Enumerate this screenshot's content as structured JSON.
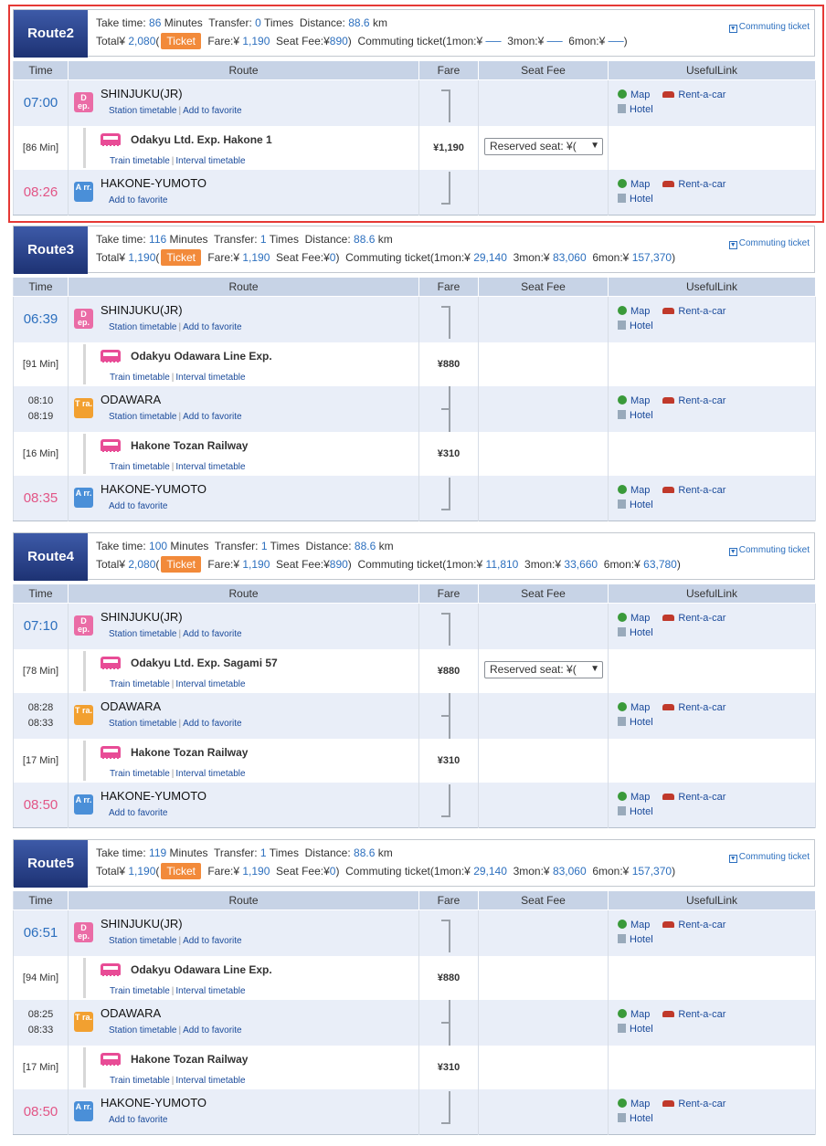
{
  "labels": {
    "time": "Time",
    "route": "Route",
    "fare": "Fare",
    "seat_fee": "Seat Fee",
    "useful_link": "UsefulLink",
    "take_time": "Take time:",
    "minutes": "Minutes",
    "transfer": "Transfer:",
    "times": "Times",
    "distance": "Distance:",
    "km": "km",
    "total": "Total¥",
    "ticket": "Ticket",
    "fare_label": "Fare:¥",
    "seat_fee_label": "Seat Fee:¥",
    "commuting_open": "Commuting ticket(1mon:¥",
    "m3": "3mon:¥",
    "m6": "6mon:¥",
    "close_paren": ")",
    "commuting_link": "Commuting ticket",
    "station_timetable": "Station timetable",
    "add_favorite": "Add to favorite",
    "train_timetable": "Train timetable",
    "interval_timetable": "Interval timetable",
    "map": "Map",
    "rent_a_car": "Rent-a-car",
    "hotel": "Hotel",
    "separator": "|",
    "dep_badge": "D ep.",
    "arr_badge": "A rr.",
    "tra_badge": "T ra."
  },
  "routes": [
    {
      "name": "Route2",
      "take_time": "86",
      "transfer": "0",
      "distance": "88.6",
      "total": "2,080",
      "fare": "1,190",
      "seat_fee": "890",
      "c1": "──",
      "c3": "──",
      "c6": "──",
      "dep_time": "07:00",
      "dep_station": "SHINJUKU(JR)",
      "leg1_duration": "[86 Min]",
      "leg1_train": "Odakyu Ltd. Exp. Hakone 1",
      "leg1_fare": "¥1,190",
      "leg1_seat": "Reserved seat: ¥(",
      "arr_time": "08:26",
      "arr_station": "HAKONE-YUMOTO"
    },
    {
      "name": "Route3",
      "take_time": "116",
      "transfer": "1",
      "distance": "88.6",
      "total": "1,190",
      "fare": "1,190",
      "seat_fee": "0",
      "c1": "29,140",
      "c3": "83,060",
      "c6": "157,370",
      "dep_time": "06:39",
      "dep_station": "SHINJUKU(JR)",
      "leg1_duration": "[91 Min]",
      "leg1_train": "Odakyu Odawara Line Exp.",
      "leg1_fare": "¥880",
      "tr_arr": "08:10",
      "tr_dep": "08:19",
      "tr_station": "ODAWARA",
      "leg2_duration": "[16 Min]",
      "leg2_train": "Hakone Tozan Railway",
      "leg2_fare": "¥310",
      "arr_time": "08:35",
      "arr_station": "HAKONE-YUMOTO"
    },
    {
      "name": "Route4",
      "take_time": "100",
      "transfer": "1",
      "distance": "88.6",
      "total": "2,080",
      "fare": "1,190",
      "seat_fee": "890",
      "c1": "11,810",
      "c3": "33,660",
      "c6": "63,780",
      "dep_time": "07:10",
      "dep_station": "SHINJUKU(JR)",
      "leg1_duration": "[78 Min]",
      "leg1_train": "Odakyu Ltd. Exp. Sagami 57",
      "leg1_fare": "¥880",
      "leg1_seat": "Reserved seat: ¥(",
      "tr_arr": "08:28",
      "tr_dep": "08:33",
      "tr_station": "ODAWARA",
      "leg2_duration": "[17 Min]",
      "leg2_train": "Hakone Tozan Railway",
      "leg2_fare": "¥310",
      "arr_time": "08:50",
      "arr_station": "HAKONE-YUMOTO"
    },
    {
      "name": "Route5",
      "take_time": "119",
      "transfer": "1",
      "distance": "88.6",
      "total": "1,190",
      "fare": "1,190",
      "seat_fee": "0",
      "c1": "29,140",
      "c3": "83,060",
      "c6": "157,370",
      "dep_time": "06:51",
      "dep_station": "SHINJUKU(JR)",
      "leg1_duration": "[94 Min]",
      "leg1_train": "Odakyu Odawara Line Exp.",
      "leg1_fare": "¥880",
      "tr_arr": "08:25",
      "tr_dep": "08:33",
      "tr_station": "ODAWARA",
      "leg2_duration": "[17 Min]",
      "leg2_train": "Hakone Tozan Railway",
      "leg2_fare": "¥310",
      "arr_time": "08:50",
      "arr_station": "HAKONE-YUMOTO"
    }
  ]
}
